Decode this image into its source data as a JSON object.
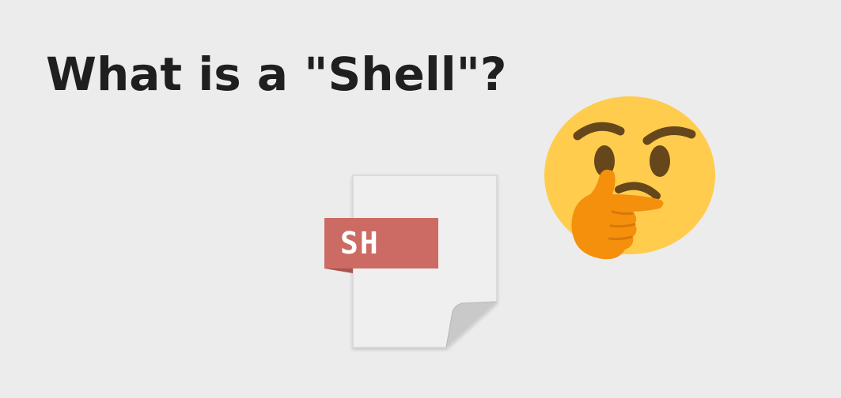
{
  "slide": {
    "title": "What is a \"Shell\"?"
  },
  "file_icon": {
    "label": "SH",
    "label_color": "#cc6b63",
    "icon": "sh-file-icon"
  },
  "emoji": {
    "icon": "thinking-face-icon",
    "face_color": "#ffcc4d",
    "hand_color": "#f4900c"
  }
}
